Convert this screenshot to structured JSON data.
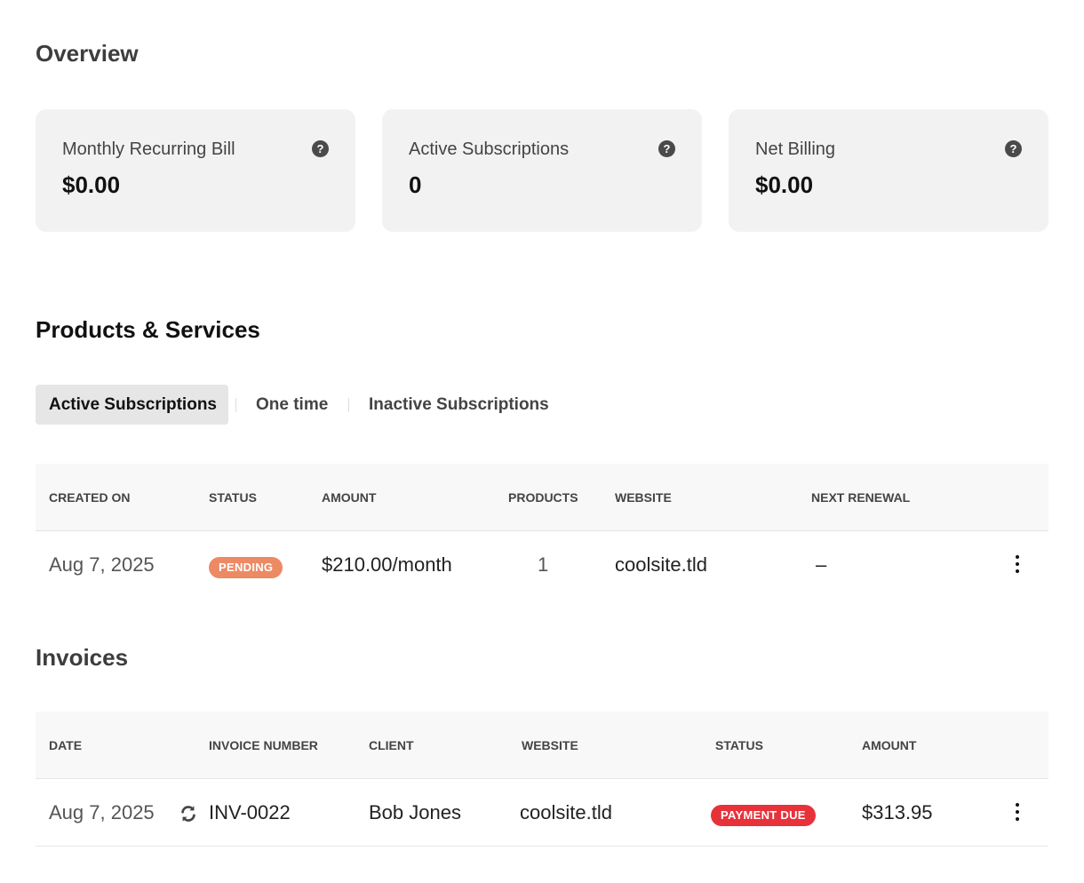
{
  "overview": {
    "title": "Overview",
    "cards": [
      {
        "label": "Monthly Recurring Bill",
        "value": "$0.00",
        "icon": "help-icon"
      },
      {
        "label": "Active Subscriptions",
        "value": "0",
        "icon": "help-icon"
      },
      {
        "label": "Net Billing",
        "value": "$0.00",
        "icon": "help-icon"
      }
    ],
    "help_glyph": "?"
  },
  "products": {
    "title": "Products & Services",
    "tabs": [
      {
        "label": "Active Subscriptions",
        "active": true
      },
      {
        "label": "One time",
        "active": false
      },
      {
        "label": "Inactive Subscriptions",
        "active": false
      }
    ],
    "columns": [
      "CREATED ON",
      "STATUS",
      "AMOUNT",
      "PRODUCTS",
      "WEBSITE",
      "NEXT RENEWAL"
    ],
    "rows": [
      {
        "created_on": "Aug 7, 2025",
        "status": "PENDING",
        "amount": "$210.00/month",
        "products": "1",
        "website": "coolsite.tld",
        "next_renewal": "–"
      }
    ]
  },
  "invoices": {
    "title": "Invoices",
    "columns": [
      "DATE",
      "INVOICE NUMBER",
      "CLIENT",
      "WEBSITE",
      "STATUS",
      "AMOUNT"
    ],
    "rows": [
      {
        "date": "Aug 7, 2025",
        "recurring_icon": "refresh-icon",
        "invoice_number": "INV-0022",
        "client": "Bob Jones",
        "website": "coolsite.tld",
        "status": "PAYMENT DUE",
        "amount": "$313.95"
      }
    ]
  },
  "colors": {
    "pending_badge": "#ec8a64",
    "payment_due_badge": "#e8323a",
    "card_bg": "#f2f2f2",
    "active_tab_bg": "#e6e6e6"
  }
}
